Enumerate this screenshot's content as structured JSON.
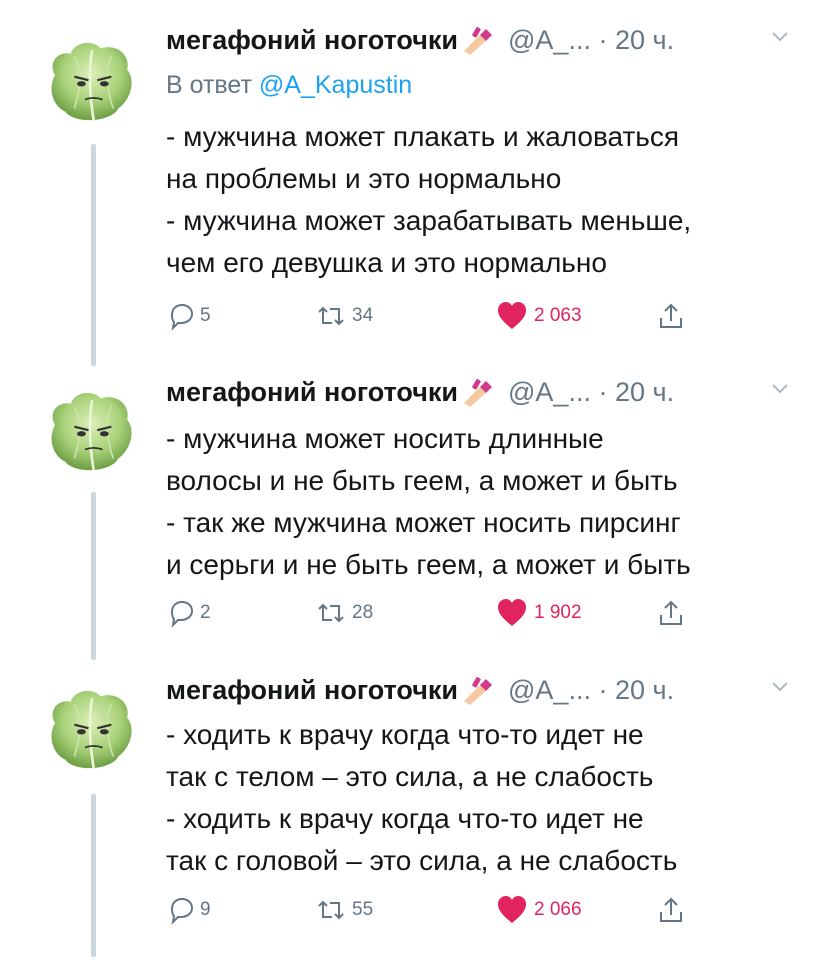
{
  "colors": {
    "accent": "#1da1f2",
    "like": "#e0245e",
    "muted": "#657786",
    "text": "#14171a",
    "thread": "#ccd6dd"
  },
  "icons": {
    "reply": "speech-bubble-icon",
    "retweet": "retweet-arrows-icon",
    "like": "heart-icon",
    "share": "share-upload-icon",
    "more": "chevron-down-icon",
    "emoji": "nail-polish-emoji",
    "avatar": "cabbage-face"
  },
  "tweets": [
    {
      "author_name": "мегафоний ноготочки",
      "handle": "@А_...",
      "time": "· 20 ч.",
      "reply_prefix": "В ответ",
      "reply_handle": "@A_Kapustin",
      "text": "- мужчина может плакать и жаловаться\nна проблемы и это нормально\n- мужчина может зарабатывать меньше,\nчем его девушка и это нормально",
      "replies": "5",
      "retweets": "34",
      "likes": "2 063"
    },
    {
      "author_name": "мегафоний ноготочки",
      "handle": "@А_...",
      "time": "· 20 ч.",
      "text": "- мужчина может носить длинные\nволосы и не быть геем, а может и быть\n- так же мужчина может носить пирсинг\nи серьги и не быть геем, а может и быть",
      "replies": "2",
      "retweets": "28",
      "likes": "1 902"
    },
    {
      "author_name": "мегафоний ноготочки",
      "handle": "@А_...",
      "time": "· 20 ч.",
      "text": "- ходить к врачу когда что-то идет не\nтак с телом – это сила, а не слабость\n- ходить к врачу когда что-то идет не\nтак с головой – это сила, а не слабость",
      "replies": "9",
      "retweets": "55",
      "likes": "2 066"
    }
  ]
}
